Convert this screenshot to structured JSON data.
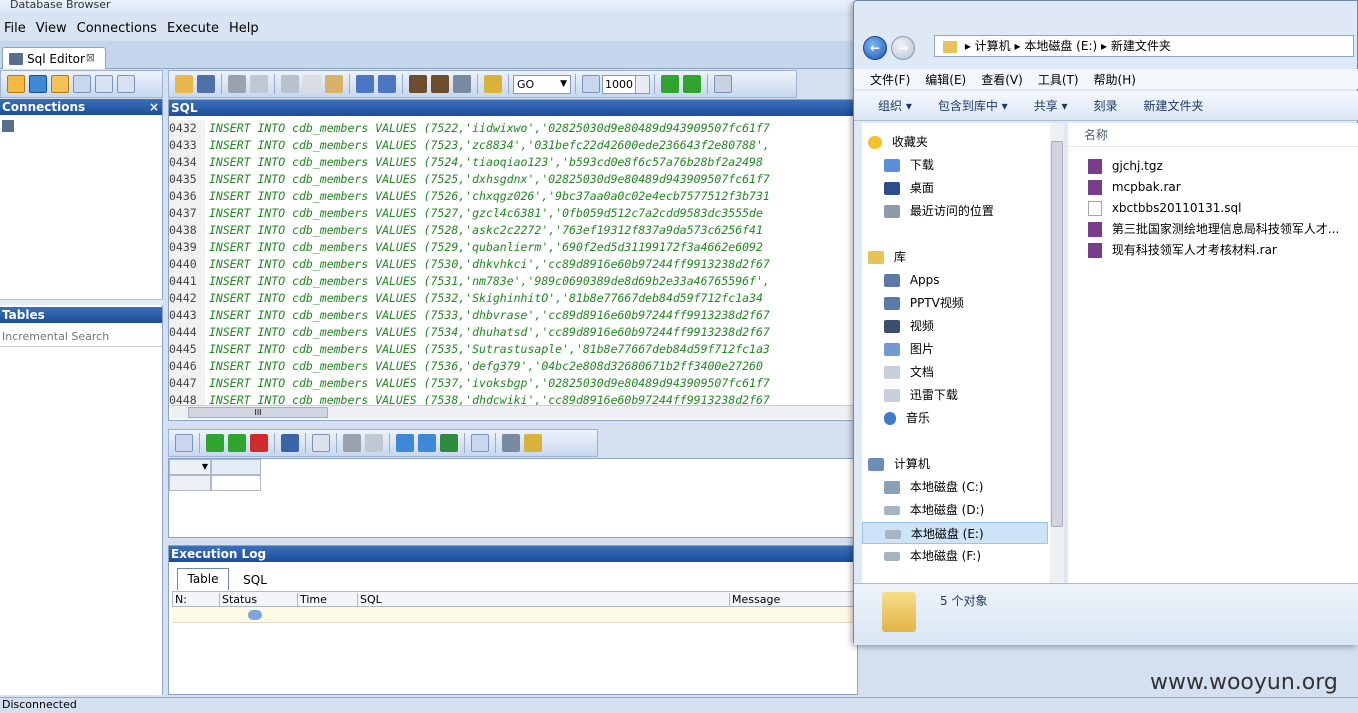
{
  "app": {
    "title": "Database Browser"
  },
  "menu": [
    "File",
    "View",
    "Connections",
    "Execute",
    "Help"
  ],
  "editor_tab": {
    "label": "Sql Editor",
    "close": "⊠"
  },
  "toolbar": {
    "go_label": "GO",
    "limit_value": "1000"
  },
  "left_panel": {
    "connections_title": "Connections",
    "close": "×",
    "tables_title": "Tables",
    "search_placeholder": "Incremental Search"
  },
  "sql_panel": {
    "title": "SQL",
    "lines": [
      {
        "n": "0432",
        "text": "INSERT INTO cdb_members VALUES (7522,'iidwixwo','02825030d9e80489d943909507fc61f7"
      },
      {
        "n": "0433",
        "text": "INSERT INTO cdb_members VALUES (7523,'zc8834','031befc22d42600ede236643f2e80788',"
      },
      {
        "n": "0434",
        "text": "INSERT INTO cdb_members VALUES (7524,'tiaoqiao123','b593cd0e8f6c57a76b28bf2a2498"
      },
      {
        "n": "0435",
        "text": "INSERT INTO cdb_members VALUES (7525,'dxhsgdnx','02825030d9e80489d943909507fc61f7"
      },
      {
        "n": "0436",
        "text": "INSERT INTO cdb_members VALUES (7526,'chxqgz026','9bc37aa0a0c02e4ecb7577512f3b731"
      },
      {
        "n": "0437",
        "text": "INSERT INTO cdb_members VALUES (7527,'gzcl4c6381','0fb059d512c7a2cdd9583dc3555de"
      },
      {
        "n": "0438",
        "text": "INSERT INTO cdb_members VALUES (7528,'askc2c2272','763ef19312f837a9da573c6256f41"
      },
      {
        "n": "0439",
        "text": "INSERT INTO cdb_members VALUES (7529,'qubanlierm','690f2ed5d31199172f3a4662e6092"
      },
      {
        "n": "0440",
        "text": "INSERT INTO cdb_members VALUES (7530,'dhkvhkci','cc89d8916e60b97244ff9913238d2f67"
      },
      {
        "n": "0441",
        "text": "INSERT INTO cdb_members VALUES (7531,'nm783e','989c0690389de8d69b2e33a46765596f',"
      },
      {
        "n": "0442",
        "text": "INSERT INTO cdb_members VALUES (7532,'SkighinhitO','81b8e77667deb84d59f712fc1a34"
      },
      {
        "n": "0443",
        "text": "INSERT INTO cdb_members VALUES (7533,'dhbvrase','cc89d8916e60b97244ff9913238d2f67"
      },
      {
        "n": "0444",
        "text": "INSERT INTO cdb_members VALUES (7534,'dhuhatsd','cc89d8916e60b97244ff9913238d2f67"
      },
      {
        "n": "0445",
        "text": "INSERT INTO cdb_members VALUES (7535,'Sutrastusaple','81b8e77667deb84d59f712fc1a3"
      },
      {
        "n": "0446",
        "text": "INSERT INTO cdb_members VALUES (7536,'defg379','04bc2e808d32680671b2ff3400e27260"
      },
      {
        "n": "0447",
        "text": "INSERT INTO cdb_members VALUES (7537,'ivoksbgp','02825030d9e80489d943909507fc61f7"
      },
      {
        "n": "0448",
        "text": "INSERT INTO cdb_members VALUES (7538,'dhdcwiki','cc89d8916e60b97244ff9913238d2f67"
      }
    ],
    "scroll_grip": "III"
  },
  "exec_log": {
    "title": "Execution Log",
    "tabs": [
      "Table",
      "SQL"
    ],
    "columns": [
      "N:",
      "Status",
      "Time",
      "SQL",
      "Message"
    ]
  },
  "status_bar": {
    "text": "Disconnected"
  },
  "explorer": {
    "breadcrumb": [
      "计算机",
      "本地磁盘 (E:)",
      "新建文件夹"
    ],
    "menu": [
      "文件(F)",
      "编辑(E)",
      "查看(V)",
      "工具(T)",
      "帮助(H)"
    ],
    "commands": [
      "组织 ▾",
      "包含到库中 ▾",
      "共享 ▾",
      "刻录",
      "新建文件夹"
    ],
    "nav": {
      "favorites": {
        "title": "收藏夹",
        "items": [
          "下载",
          "桌面",
          "最近访问的位置"
        ]
      },
      "libraries": {
        "title": "库",
        "items": [
          "Apps",
          "PPTV视频",
          "视频",
          "图片",
          "文档",
          "迅雷下载",
          "音乐"
        ]
      },
      "computer": {
        "title": "计算机",
        "items": [
          "本地磁盘 (C:)",
          "本地磁盘 (D:)",
          "本地磁盘 (E:)",
          "本地磁盘 (F:)"
        ]
      }
    },
    "column_name": "名称",
    "files": [
      "gjchj.tgz",
      "mcpbak.rar",
      "xbctbbs20110131.sql",
      "第三批国家测绘地理信息局科技领军人才...",
      "现有科技领军人才考核材料.rar"
    ],
    "status": "5 个对象"
  },
  "watermark": "www.wooyun.org",
  "colors": {
    "panel_head": "#1d4e9a",
    "sql_text": "#1e8a1e",
    "selected_drive": "#cde3f7"
  }
}
